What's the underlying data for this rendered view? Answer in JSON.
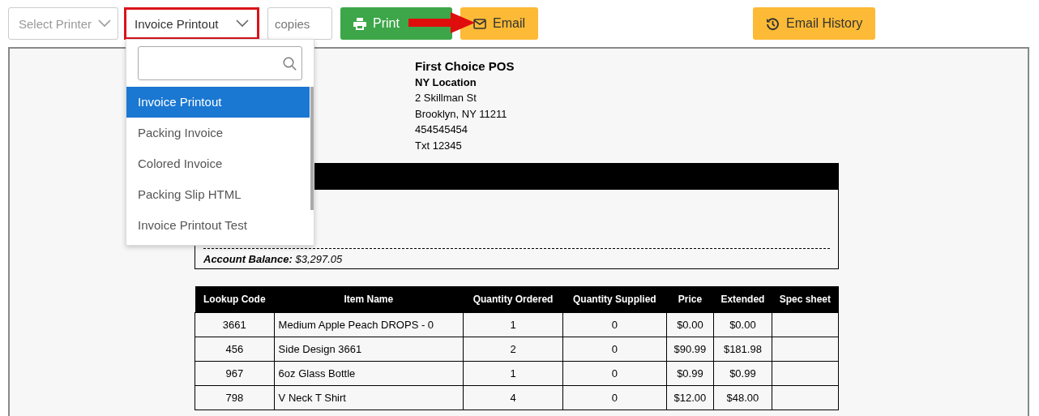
{
  "toolbar": {
    "printer_select": {
      "placeholder": "Select Printer"
    },
    "template_select": {
      "value": "Invoice Printout",
      "highlighted": true
    },
    "copies": {
      "placeholder": "copies"
    },
    "print_button": "Print",
    "email_button": "Email",
    "history_button": "Email History"
  },
  "dropdown": {
    "items": [
      {
        "label": "Invoice Printout",
        "selected": true
      },
      {
        "label": "Packing Invoice",
        "selected": false
      },
      {
        "label": "Colored Invoice",
        "selected": false
      },
      {
        "label": "Packing Slip HTML",
        "selected": false
      },
      {
        "label": "Invoice Printout Test",
        "selected": false
      }
    ]
  },
  "document": {
    "company": "First Choice POS",
    "location": "NY Location",
    "address_lines": [
      "2 Skillman St",
      "Brooklyn, NY 11211",
      "454545454",
      "Txt 12345"
    ],
    "account_balance": "**Account Balance:** $3,297.05",
    "table": {
      "columns": [
        "Lookup Code",
        "Item Name",
        "Quantity Ordered",
        "Quantity Supplied",
        "Price",
        "Extended",
        "Spec sheet"
      ],
      "rows": [
        [
          "3661",
          "Medium Apple Peach DROPS - 0",
          "1",
          "0",
          "$0.00",
          "$0.00",
          ""
        ],
        [
          "456",
          "Side Design 3661",
          "2",
          "0",
          "$90.99",
          "$181.98",
          ""
        ],
        [
          "967",
          "6oz Glass Bottle",
          "1",
          "0",
          "$0.99",
          "$0.99",
          ""
        ],
        [
          "798",
          "V Neck T Shirt",
          "4",
          "0",
          "$12.00",
          "$48.00",
          ""
        ]
      ]
    }
  }
}
